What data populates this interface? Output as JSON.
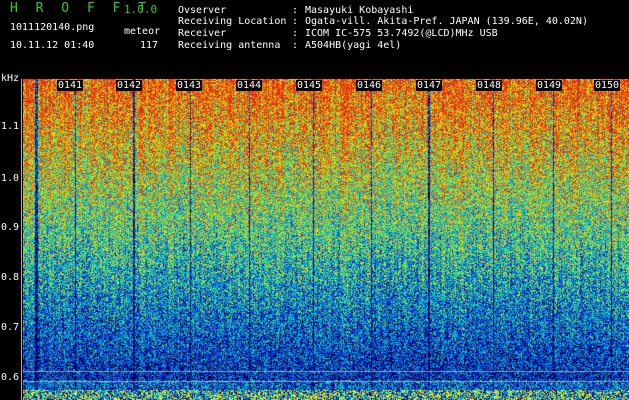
{
  "header": {
    "title": "H R O F F T",
    "version": "1.0.0",
    "filename": "1011120140.png",
    "mode": "meteor",
    "datetime": "10.11.12 01:40",
    "count": "117"
  },
  "info": [
    {
      "label": "Ovserver",
      "value": "Masayuki Kobayashi"
    },
    {
      "label": "Receiving Location",
      "value": "Ogata-vill. Akita-Pref. JAPAN (139.96E, 40.02N)"
    },
    {
      "label": "Receiver",
      "value": "ICOM IC-575 53.7492(@LCD)MHz USB"
    },
    {
      "label": "Receiving antenna",
      "value": "A504HB(yagi 4el)"
    }
  ],
  "colon": ":",
  "axis": {
    "unit": "kHz",
    "y_labels": [
      "1.1",
      "1.0",
      "0.9",
      "0.8",
      "0.7",
      "0.6"
    ],
    "x_labels": [
      "0141",
      "0142",
      "0143",
      "0144",
      "0145",
      "0146",
      "0147",
      "0148",
      "0149",
      "0150"
    ]
  },
  "colors": {
    "title": "#33cc33",
    "text": "#ffffff",
    "background": "#000000"
  }
}
